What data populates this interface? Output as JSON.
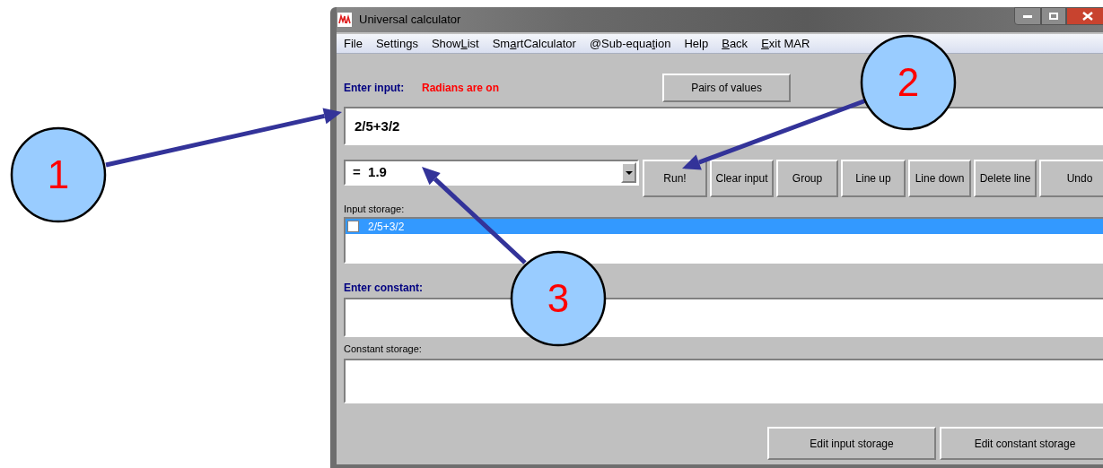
{
  "window": {
    "title": "Universal calculator"
  },
  "menu": [
    {
      "label": "File"
    },
    {
      "label": "Settings"
    },
    {
      "before": "Show",
      "access_key": "L",
      "after": "ist"
    },
    {
      "before": "Sm",
      "access_key": "a",
      "after": "rtCalculator"
    },
    {
      "before": "@Sub-equa",
      "access_key": "t",
      "after": "ion"
    },
    {
      "label": "Help"
    },
    {
      "access_key": "B",
      "after": "ack"
    },
    {
      "access_key": "E",
      "after": "xit MAR"
    }
  ],
  "input_label": "Enter input:",
  "radians_status": "Radians are on",
  "pairs_button": "Pairs of values",
  "input_value": "2/5+3/2",
  "result_value": "=  1.9",
  "buttons": [
    "Run!",
    "Clear input",
    "Group",
    "Line up",
    "Line down",
    "Delete line",
    "Undo"
  ],
  "input_storage_label": "Input storage:",
  "input_storage": [
    {
      "text": "2/5+3/2",
      "checked": false,
      "selected": true
    }
  ],
  "constant_label": "Enter constant:",
  "constant_storage_label": "Constant storage:",
  "bottom_buttons": [
    "Edit input storage",
    "Edit constant storage"
  ],
  "callouts": [
    {
      "label": "1"
    },
    {
      "label": "2"
    },
    {
      "label": "3"
    }
  ]
}
